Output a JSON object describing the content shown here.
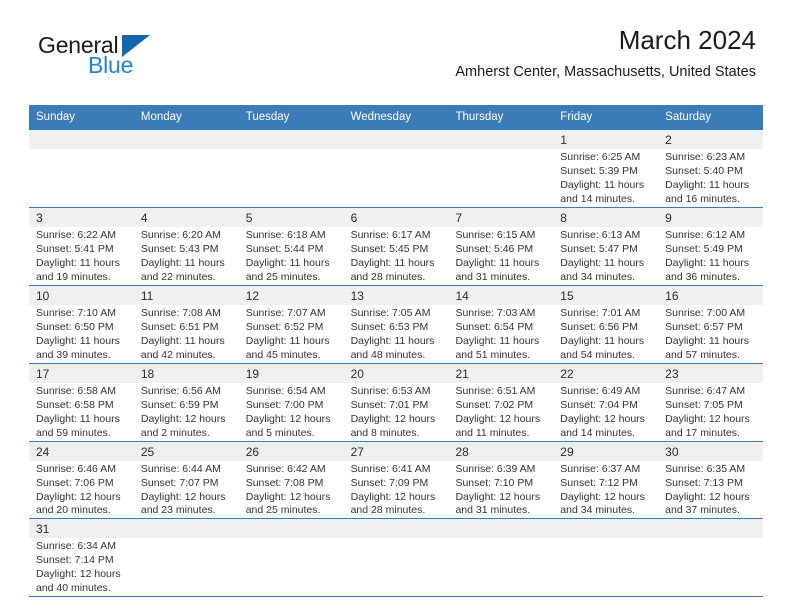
{
  "brand": {
    "name_part1": "General",
    "name_part2": "Blue",
    "triangle_color": "#1166ad",
    "blue_color": "#1f86d0"
  },
  "header": {
    "title": "March 2024",
    "subtitle": "Amherst Center, Massachusetts, United States"
  },
  "theme": {
    "header_blue": "#3b7cb8",
    "day_strip_grey": "#f0f0f0",
    "text": "#333333"
  },
  "weekdays": [
    "Sunday",
    "Monday",
    "Tuesday",
    "Wednesday",
    "Thursday",
    "Friday",
    "Saturday"
  ],
  "labels": {
    "sunrise": "Sunrise:",
    "sunset": "Sunset:",
    "daylight": "Daylight:"
  },
  "weeks": [
    [
      {
        "day": "",
        "empty": true
      },
      {
        "day": "",
        "empty": true
      },
      {
        "day": "",
        "empty": true
      },
      {
        "day": "",
        "empty": true
      },
      {
        "day": "",
        "empty": true
      },
      {
        "day": "1",
        "sunrise": "Sunrise: 6:25 AM",
        "sunset": "Sunset: 5:39 PM",
        "daylight": "Daylight: 11 hours and 14 minutes."
      },
      {
        "day": "2",
        "sunrise": "Sunrise: 6:23 AM",
        "sunset": "Sunset: 5:40 PM",
        "daylight": "Daylight: 11 hours and 16 minutes."
      }
    ],
    [
      {
        "day": "3",
        "sunrise": "Sunrise: 6:22 AM",
        "sunset": "Sunset: 5:41 PM",
        "daylight": "Daylight: 11 hours and 19 minutes."
      },
      {
        "day": "4",
        "sunrise": "Sunrise: 6:20 AM",
        "sunset": "Sunset: 5:43 PM",
        "daylight": "Daylight: 11 hours and 22 minutes."
      },
      {
        "day": "5",
        "sunrise": "Sunrise: 6:18 AM",
        "sunset": "Sunset: 5:44 PM",
        "daylight": "Daylight: 11 hours and 25 minutes."
      },
      {
        "day": "6",
        "sunrise": "Sunrise: 6:17 AM",
        "sunset": "Sunset: 5:45 PM",
        "daylight": "Daylight: 11 hours and 28 minutes."
      },
      {
        "day": "7",
        "sunrise": "Sunrise: 6:15 AM",
        "sunset": "Sunset: 5:46 PM",
        "daylight": "Daylight: 11 hours and 31 minutes."
      },
      {
        "day": "8",
        "sunrise": "Sunrise: 6:13 AM",
        "sunset": "Sunset: 5:47 PM",
        "daylight": "Daylight: 11 hours and 34 minutes."
      },
      {
        "day": "9",
        "sunrise": "Sunrise: 6:12 AM",
        "sunset": "Sunset: 5:49 PM",
        "daylight": "Daylight: 11 hours and 36 minutes."
      }
    ],
    [
      {
        "day": "10",
        "sunrise": "Sunrise: 7:10 AM",
        "sunset": "Sunset: 6:50 PM",
        "daylight": "Daylight: 11 hours and 39 minutes."
      },
      {
        "day": "11",
        "sunrise": "Sunrise: 7:08 AM",
        "sunset": "Sunset: 6:51 PM",
        "daylight": "Daylight: 11 hours and 42 minutes."
      },
      {
        "day": "12",
        "sunrise": "Sunrise: 7:07 AM",
        "sunset": "Sunset: 6:52 PM",
        "daylight": "Daylight: 11 hours and 45 minutes."
      },
      {
        "day": "13",
        "sunrise": "Sunrise: 7:05 AM",
        "sunset": "Sunset: 6:53 PM",
        "daylight": "Daylight: 11 hours and 48 minutes."
      },
      {
        "day": "14",
        "sunrise": "Sunrise: 7:03 AM",
        "sunset": "Sunset: 6:54 PM",
        "daylight": "Daylight: 11 hours and 51 minutes."
      },
      {
        "day": "15",
        "sunrise": "Sunrise: 7:01 AM",
        "sunset": "Sunset: 6:56 PM",
        "daylight": "Daylight: 11 hours and 54 minutes."
      },
      {
        "day": "16",
        "sunrise": "Sunrise: 7:00 AM",
        "sunset": "Sunset: 6:57 PM",
        "daylight": "Daylight: 11 hours and 57 minutes."
      }
    ],
    [
      {
        "day": "17",
        "sunrise": "Sunrise: 6:58 AM",
        "sunset": "Sunset: 6:58 PM",
        "daylight": "Daylight: 11 hours and 59 minutes."
      },
      {
        "day": "18",
        "sunrise": "Sunrise: 6:56 AM",
        "sunset": "Sunset: 6:59 PM",
        "daylight": "Daylight: 12 hours and 2 minutes."
      },
      {
        "day": "19",
        "sunrise": "Sunrise: 6:54 AM",
        "sunset": "Sunset: 7:00 PM",
        "daylight": "Daylight: 12 hours and 5 minutes."
      },
      {
        "day": "20",
        "sunrise": "Sunrise: 6:53 AM",
        "sunset": "Sunset: 7:01 PM",
        "daylight": "Daylight: 12 hours and 8 minutes."
      },
      {
        "day": "21",
        "sunrise": "Sunrise: 6:51 AM",
        "sunset": "Sunset: 7:02 PM",
        "daylight": "Daylight: 12 hours and 11 minutes."
      },
      {
        "day": "22",
        "sunrise": "Sunrise: 6:49 AM",
        "sunset": "Sunset: 7:04 PM",
        "daylight": "Daylight: 12 hours and 14 minutes."
      },
      {
        "day": "23",
        "sunrise": "Sunrise: 6:47 AM",
        "sunset": "Sunset: 7:05 PM",
        "daylight": "Daylight: 12 hours and 17 minutes."
      }
    ],
    [
      {
        "day": "24",
        "sunrise": "Sunrise: 6:46 AM",
        "sunset": "Sunset: 7:06 PM",
        "daylight": "Daylight: 12 hours and 20 minutes."
      },
      {
        "day": "25",
        "sunrise": "Sunrise: 6:44 AM",
        "sunset": "Sunset: 7:07 PM",
        "daylight": "Daylight: 12 hours and 23 minutes."
      },
      {
        "day": "26",
        "sunrise": "Sunrise: 6:42 AM",
        "sunset": "Sunset: 7:08 PM",
        "daylight": "Daylight: 12 hours and 25 minutes."
      },
      {
        "day": "27",
        "sunrise": "Sunrise: 6:41 AM",
        "sunset": "Sunset: 7:09 PM",
        "daylight": "Daylight: 12 hours and 28 minutes."
      },
      {
        "day": "28",
        "sunrise": "Sunrise: 6:39 AM",
        "sunset": "Sunset: 7:10 PM",
        "daylight": "Daylight: 12 hours and 31 minutes."
      },
      {
        "day": "29",
        "sunrise": "Sunrise: 6:37 AM",
        "sunset": "Sunset: 7:12 PM",
        "daylight": "Daylight: 12 hours and 34 minutes."
      },
      {
        "day": "30",
        "sunrise": "Sunrise: 6:35 AM",
        "sunset": "Sunset: 7:13 PM",
        "daylight": "Daylight: 12 hours and 37 minutes."
      }
    ],
    [
      {
        "day": "31",
        "sunrise": "Sunrise: 6:34 AM",
        "sunset": "Sunset: 7:14 PM",
        "daylight": "Daylight: 12 hours and 40 minutes."
      },
      {
        "day": "",
        "empty": true
      },
      {
        "day": "",
        "empty": true
      },
      {
        "day": "",
        "empty": true
      },
      {
        "day": "",
        "empty": true
      },
      {
        "day": "",
        "empty": true
      },
      {
        "day": "",
        "empty": true
      }
    ]
  ]
}
